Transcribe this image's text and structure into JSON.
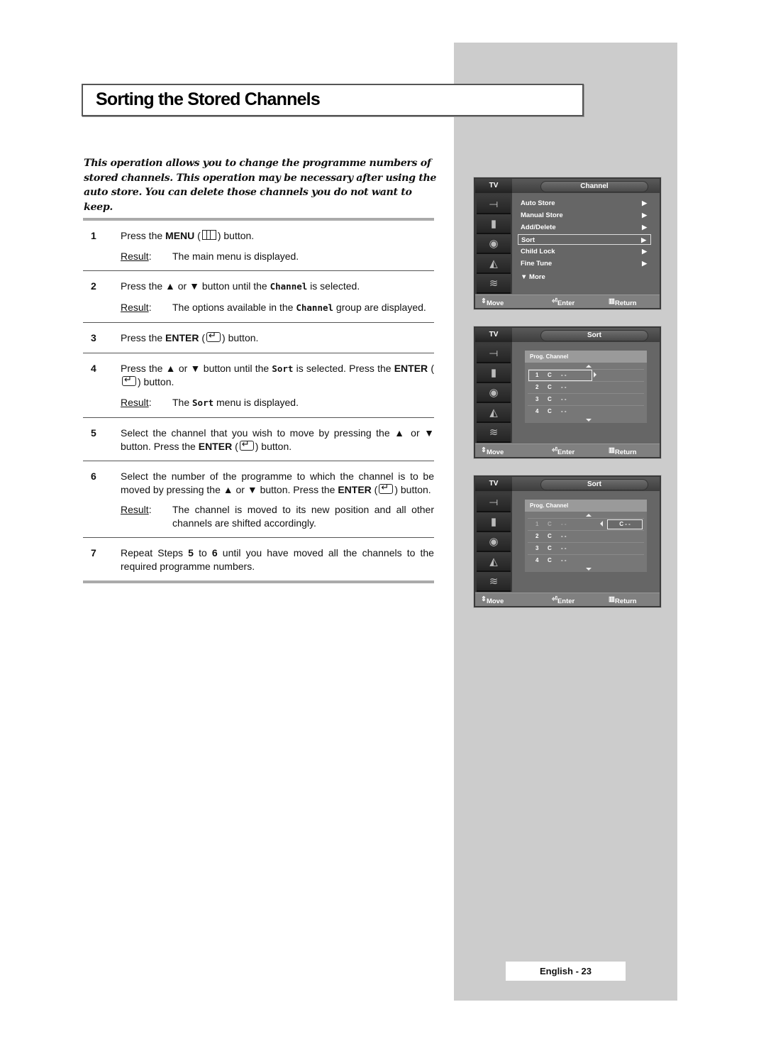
{
  "page": {
    "title": "Sorting the Stored Channels",
    "intro": "This operation allows you to change the programme numbers of stored channels. This operation may be necessary after using the auto store. You can delete those channels you do not want to keep.",
    "result_label": "Result",
    "footer": "English - 23"
  },
  "steps": [
    {
      "num": "1",
      "parts": [
        "Press the ",
        "MENU",
        " (",
        ") button."
      ],
      "result": "The main menu is displayed."
    },
    {
      "num": "2",
      "parts": [
        "Press the ▲ or ▼ button until the ",
        "Channel",
        " is selected."
      ],
      "result_parts": [
        "The options available in the ",
        "Channel",
        " group are displayed."
      ]
    },
    {
      "num": "3",
      "parts": [
        "Press the ",
        "ENTER",
        " (",
        ") button."
      ]
    },
    {
      "num": "4",
      "parts": [
        "Press the ▲ or ▼ button until the ",
        "Sort",
        " is selected. Press the ",
        "ENTER",
        " (",
        ") button."
      ],
      "result_parts": [
        "The ",
        "Sort",
        " menu is displayed."
      ]
    },
    {
      "num": "5",
      "parts": [
        "Select the channel that you wish to move by pressing the ▲ or ▼ button. Press the ",
        "ENTER",
        " (",
        ") button."
      ]
    },
    {
      "num": "6",
      "parts": [
        "Select the number of the programme to which the channel is to be moved by pressing the ▲ or ▼ button. Press the ",
        "ENTER",
        " (",
        ") button."
      ],
      "result": "The channel is moved to its new position and all other channels are shifted accordingly."
    },
    {
      "num": "7",
      "parts": [
        "Repeat Steps ",
        "5",
        " to ",
        "6",
        " until you have moved all the channels to the required programme numbers."
      ]
    }
  ],
  "tv_common": {
    "label": "TV",
    "footer_move": "Move",
    "footer_enter": "Enter",
    "footer_return": "Return",
    "side_icons": [
      "antenna-icon",
      "picture-icon",
      "speaker-icon",
      "channel-icon",
      "setup-icon"
    ]
  },
  "screen1": {
    "title": "Channel",
    "items": [
      {
        "label": "Auto Store",
        "arrow": "▶"
      },
      {
        "label": "Manual Store",
        "arrow": "▶"
      },
      {
        "label": "Add/Delete",
        "arrow": "▶"
      },
      {
        "label": "Sort",
        "arrow": "▶",
        "selected": true
      },
      {
        "label": "Child Lock",
        "arrow": "▶"
      },
      {
        "label": "Fine Tune",
        "arrow": "▶"
      },
      {
        "label": "▼ More",
        "arrow": ""
      }
    ]
  },
  "screen2": {
    "title": "Sort",
    "header": "Prog. Channel",
    "rows": [
      {
        "num": "1",
        "ch": "C",
        "val": "- -"
      },
      {
        "num": "2",
        "ch": "C",
        "val": "- -"
      },
      {
        "num": "3",
        "ch": "C",
        "val": "- -"
      },
      {
        "num": "4",
        "ch": "C",
        "val": "- -"
      }
    ]
  },
  "screen3": {
    "title": "Sort",
    "header": "Prog. Channel",
    "rows": [
      {
        "num": "1",
        "ch": "C",
        "val": "- -"
      },
      {
        "num": "2",
        "ch": "C",
        "val": "- -"
      },
      {
        "num": "3",
        "ch": "C",
        "val": "- -"
      },
      {
        "num": "4",
        "ch": "C",
        "val": "- -"
      }
    ],
    "target": "C  - -"
  }
}
